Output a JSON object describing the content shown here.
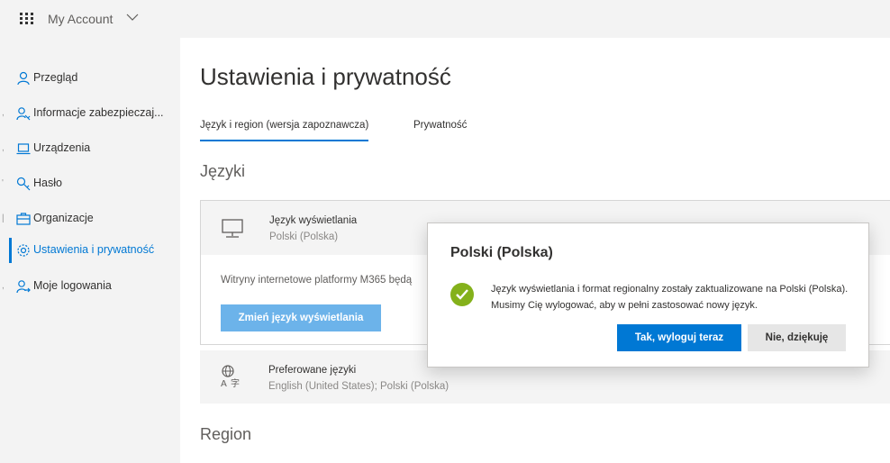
{
  "topbar": {
    "app_title": "My Account"
  },
  "sidebar": {
    "items": [
      {
        "label": "Przegląd"
      },
      {
        "label": "Informacje zabezpieczaj..."
      },
      {
        "label": "Urządzenia"
      },
      {
        "label": "Hasło"
      },
      {
        "label": "Organizacje"
      },
      {
        "label": "Ustawienia i prywatność"
      },
      {
        "label": "Moje logowania"
      }
    ]
  },
  "main": {
    "title": "Ustawienia i prywatność",
    "tabs": [
      {
        "label": "Język i region (wersja zapoznawcza)"
      },
      {
        "label": "Prywatność"
      }
    ],
    "languages_heading": "Języki",
    "display_language": {
      "title": "Język wyświetlania",
      "value": "Polski (Polska)",
      "description": "Witryny internetowe platformy M365 będą",
      "button": "Zmień język wyświetlania"
    },
    "preferred_languages": {
      "title": "Preferowane języki",
      "value": "English (United States); Polski (Polska)"
    },
    "region_heading": "Region"
  },
  "modal": {
    "title": "Polski (Polska)",
    "message": "Język wyświetlania i format regionalny zostały zaktualizowane na Polski (Polska). Musimy Cię wylogować, aby w pełni zastosować nowy język.",
    "primary_button": "Tak, wyloguj teraz",
    "secondary_button": "Nie, dziękuję"
  },
  "colors": {
    "accent": "#0078d4",
    "success": "#84b11b",
    "sidebar_bg": "#f3f3f3"
  }
}
